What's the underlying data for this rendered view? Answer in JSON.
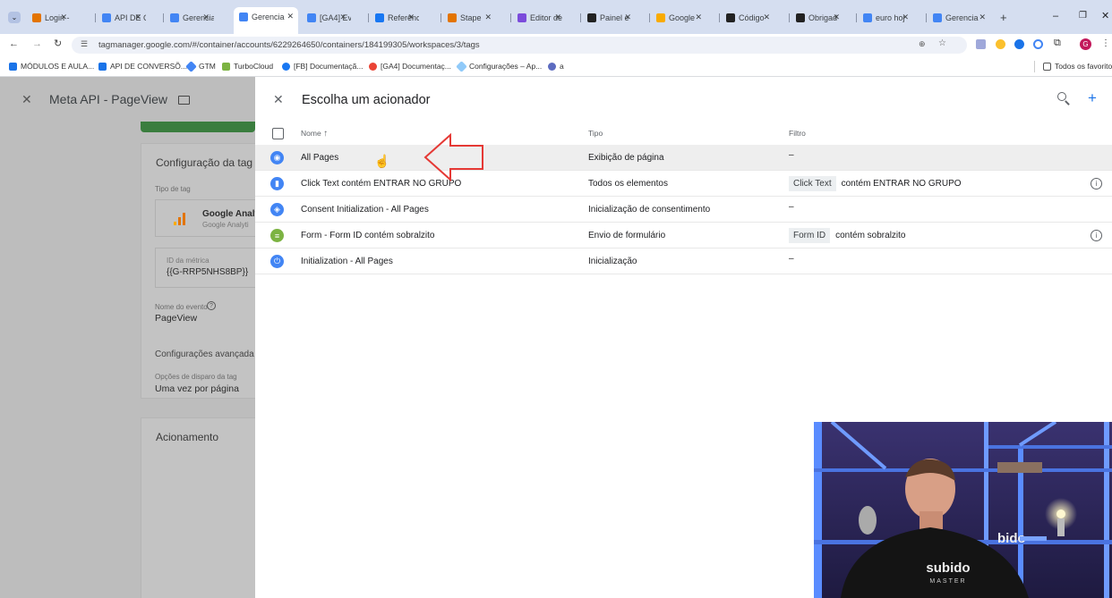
{
  "browser": {
    "tabs": [
      {
        "label": "Login -",
        "color": "#e37400"
      },
      {
        "label": "API DE C",
        "color": "#4285f4"
      },
      {
        "label": "Gerencia",
        "color": "#4285f4"
      },
      {
        "label": "Gerencia",
        "color": "#4285f4",
        "active": true
      },
      {
        "label": "[GA4] Ev",
        "color": "#4285f4"
      },
      {
        "label": "Referênc",
        "color": "#1877f2"
      },
      {
        "label": "Stape",
        "color": "#e37400"
      },
      {
        "label": "Editor de",
        "color": "#7b4bdb"
      },
      {
        "label": "Painel e",
        "color": "#222"
      },
      {
        "label": "Google",
        "color": "#f9ab00"
      },
      {
        "label": "Código",
        "color": "#222"
      },
      {
        "label": "Obrigad",
        "color": "#222"
      },
      {
        "label": "euro hoj",
        "color": "#4285f4"
      },
      {
        "label": "Gerencia",
        "color": "#4285f4"
      }
    ],
    "new_tab": "+",
    "url": "tagmanager.google.com/#/container/accounts/6229264650/containers/184199305/workspaces/3/tags",
    "bookmarks": [
      "MÓDULOS E AULA...",
      "API DE CONVERSÕ...",
      "GTM",
      "TurboCloud",
      "[FB] Documentaçã...",
      "[GA4] Documentaç...",
      "Configurações – Ap...",
      "a"
    ],
    "all_bookmarks": "Todos os favoritos"
  },
  "background": {
    "tag_title": "Meta API - PageView",
    "config_title": "Configuração da tag",
    "tag_type_label": "Tipo de tag",
    "tag_type_name": "Google Analy",
    "tag_type_sub": "Google Analyti",
    "metric_id_label": "ID da métrica",
    "metric_id_value": "{{G-RRP5NHS8BP}}",
    "event_name_label": "Nome do evento",
    "event_name_value": "PageView",
    "advanced": "Configurações avançada",
    "firing_label": "Opções de disparo da tag",
    "firing_value": "Uma vez por página",
    "trigger_title": "Acionamento"
  },
  "panel": {
    "title": "Escolha um acionador",
    "col_name": "Nome",
    "col_type": "Tipo",
    "col_filter": "Filtro",
    "rows": [
      {
        "name": "All Pages",
        "type": "Exibição de página",
        "chip": "",
        "filter": "–",
        "color": "#4285f4",
        "icon": "eye-icon",
        "glyph": "◉"
      },
      {
        "name": "Click Text contém ENTRAR NO GRUPO",
        "type": "Todos os elementos",
        "chip": "Click Text",
        "filter": "contém ENTRAR NO GRUPO",
        "color": "#4285f4",
        "icon": "click-icon",
        "glyph": "▮",
        "info": true
      },
      {
        "name": "Consent Initialization - All Pages",
        "type": "Inicialização de consentimento",
        "chip": "",
        "filter": "–",
        "color": "#4285f4",
        "icon": "shield-icon",
        "glyph": "◈"
      },
      {
        "name": "Form - Form ID contém sobralzito",
        "type": "Envio de formulário",
        "chip": "Form ID",
        "filter": "contém sobralzito",
        "color": "#7cb342",
        "icon": "form-icon",
        "glyph": "≡",
        "info": true
      },
      {
        "name": "Initialization - All Pages",
        "type": "Inicialização",
        "chip": "",
        "filter": "–",
        "color": "#4285f4",
        "icon": "power-icon",
        "glyph": "⏻"
      }
    ]
  },
  "video": {
    "shirt_text": "subido",
    "shirt_sub": "MASTER",
    "sign_text": "bido"
  }
}
